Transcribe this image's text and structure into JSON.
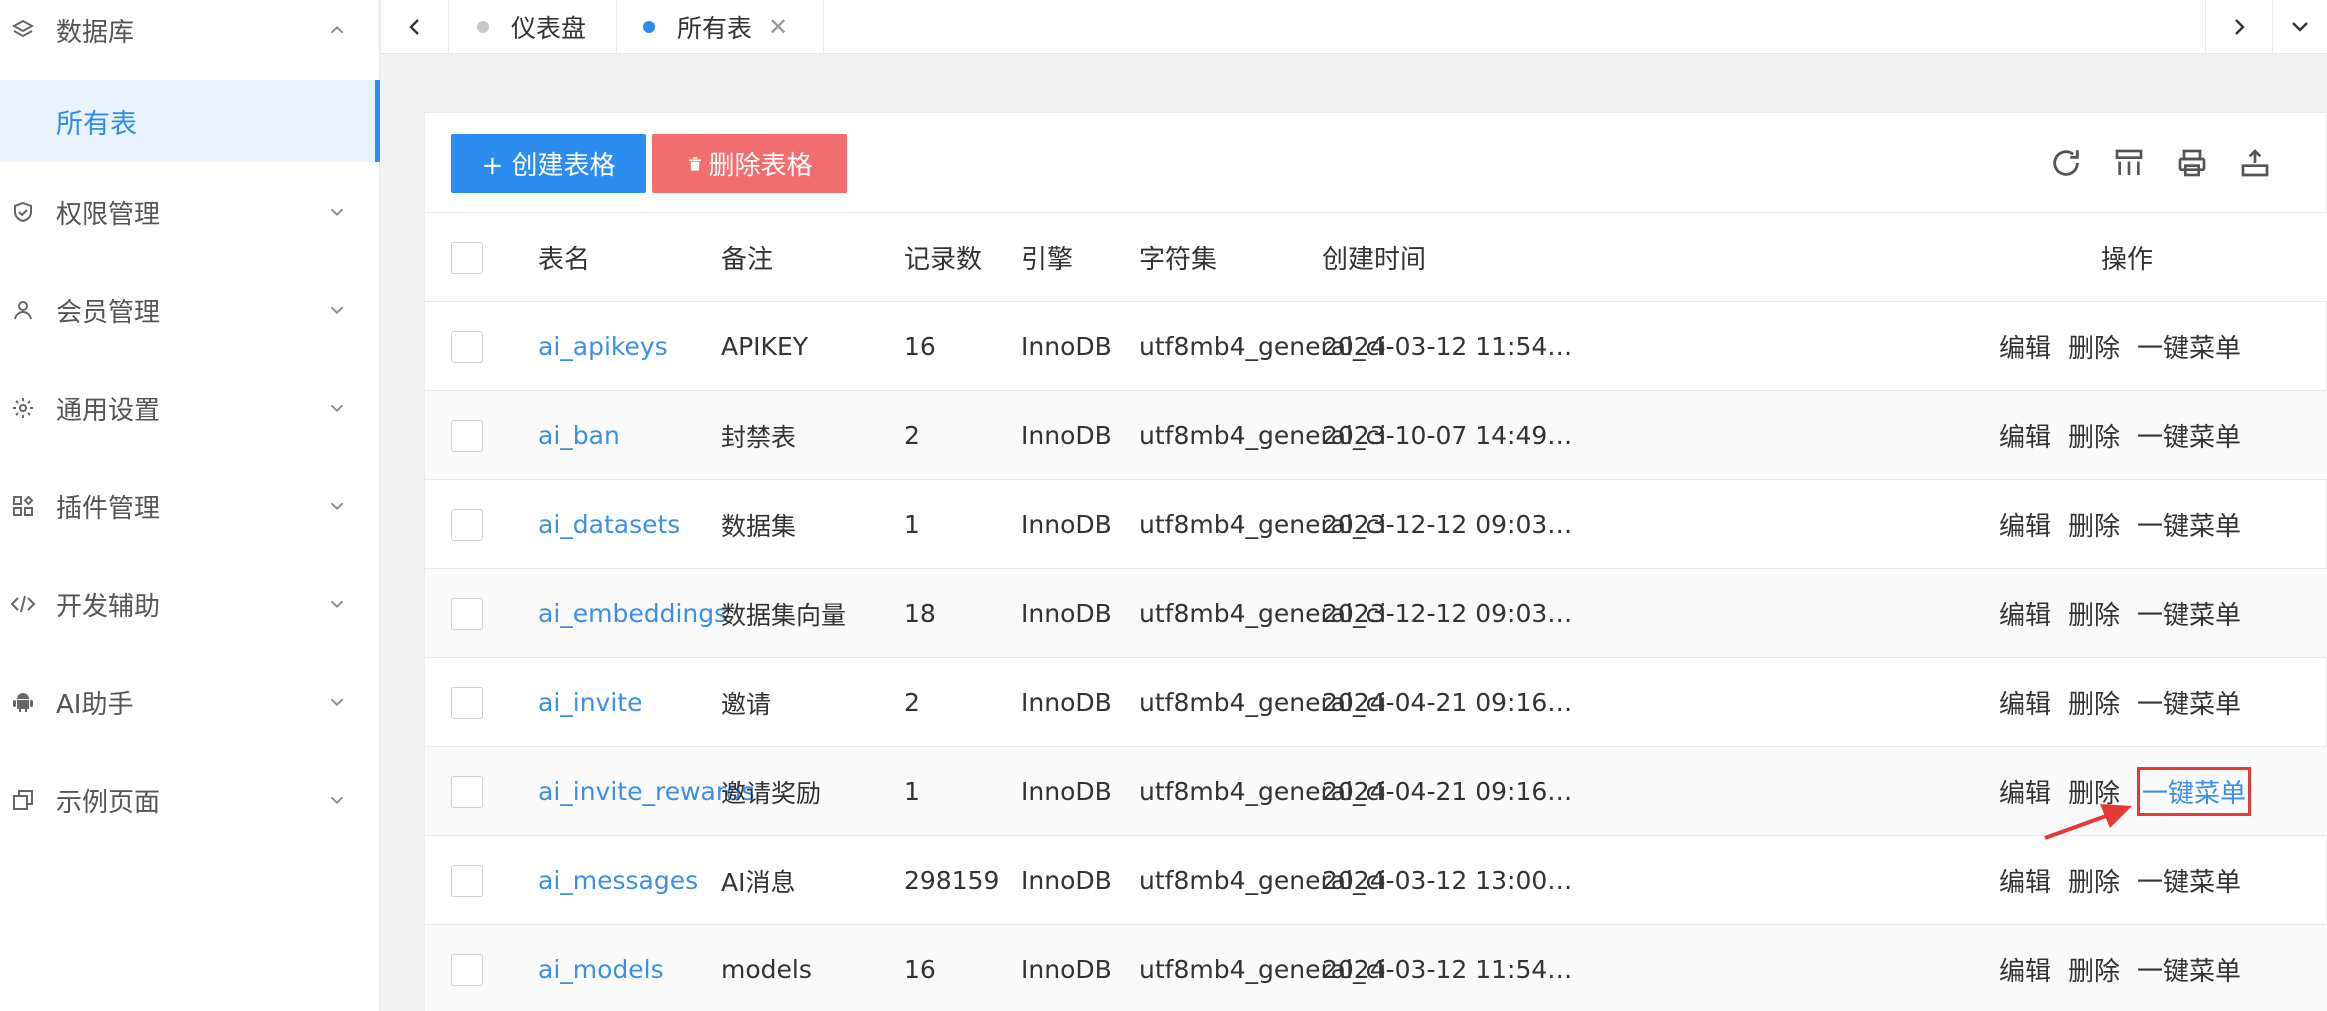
{
  "sidebar": {
    "database": "数据库",
    "all_tables": "所有表",
    "items": [
      {
        "label": "权限管理",
        "icon": "shield-icon"
      },
      {
        "label": "会员管理",
        "icon": "user-icon"
      },
      {
        "label": "通用设置",
        "icon": "gear-icon"
      },
      {
        "label": "插件管理",
        "icon": "plugin-icon"
      },
      {
        "label": "开发辅助",
        "icon": "code-icon"
      },
      {
        "label": "AI助手",
        "icon": "android-icon"
      },
      {
        "label": "示例页面",
        "icon": "pages-icon"
      }
    ]
  },
  "tabs": {
    "dashboard": "仪表盘",
    "all_tables": "所有表"
  },
  "toolbar": {
    "create": "+ 创建表格",
    "delete": "删除表格"
  },
  "table": {
    "headers": {
      "name": "表名",
      "remark": "备注",
      "records": "记录数",
      "engine": "引擎",
      "charset": "字符集",
      "created": "创建时间",
      "ops": "操作"
    },
    "ops": {
      "edit": "编辑",
      "delete": "删除",
      "menu": "一键菜单"
    },
    "rows": [
      {
        "name": "ai_apikeys",
        "remark": "APIKEY",
        "records": "16",
        "engine": "InnoDB",
        "charset": "utf8mb4_general_ci",
        "created": "2024-03-12 11:54…"
      },
      {
        "name": "ai_ban",
        "remark": "封禁表",
        "records": "2",
        "engine": "InnoDB",
        "charset": "utf8mb4_general_ci",
        "created": "2023-10-07 14:49…"
      },
      {
        "name": "ai_datasets",
        "remark": "数据集",
        "records": "1",
        "engine": "InnoDB",
        "charset": "utf8mb4_general_ci",
        "created": "2023-12-12 09:03…"
      },
      {
        "name": "ai_embeddings",
        "remark": "数据集向量",
        "records": "18",
        "engine": "InnoDB",
        "charset": "utf8mb4_general_ci",
        "created": "2023-12-12 09:03…"
      },
      {
        "name": "ai_invite",
        "remark": "邀请",
        "records": "2",
        "engine": "InnoDB",
        "charset": "utf8mb4_general_ci",
        "created": "2024-04-21 09:16…"
      },
      {
        "name": "ai_invite_rewards",
        "remark": "邀请奖励",
        "records": "1",
        "engine": "InnoDB",
        "charset": "utf8mb4_general_ci",
        "created": "2024-04-21 09:16…"
      },
      {
        "name": "ai_messages",
        "remark": "AI消息",
        "records": "298159",
        "engine": "InnoDB",
        "charset": "utf8mb4_general_ci",
        "created": "2024-03-12 13:00…"
      },
      {
        "name": "ai_models",
        "remark": "models",
        "records": "16",
        "engine": "InnoDB",
        "charset": "utf8mb4_general_ci",
        "created": "2024-03-12 11:54…"
      }
    ]
  },
  "colors": {
    "primary": "#2d8cf0",
    "danger": "#f26d6d",
    "highlight": "#e53935"
  }
}
